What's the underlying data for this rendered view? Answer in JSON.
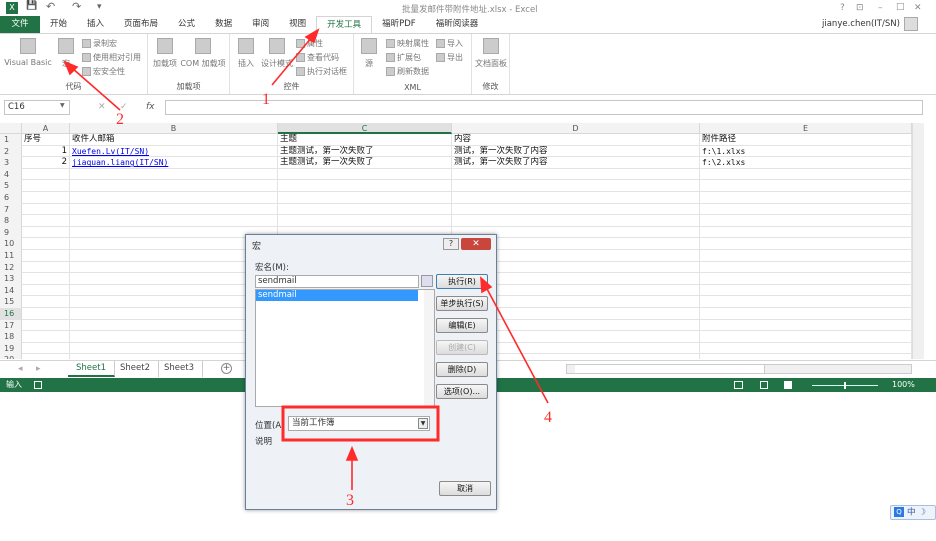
{
  "window": {
    "title": "批量发邮件带附件地址.xlsx - Excel",
    "user": "jianye.chen(IT/SN)",
    "controls": [
      "?",
      "⊡",
      "–",
      "□",
      "✕"
    ]
  },
  "quick_access": {
    "save": "💾",
    "undo": "↶",
    "redo": "↷",
    "customize": "▾"
  },
  "tabs": [
    "文件",
    "开始",
    "插入",
    "页面布局",
    "公式",
    "数据",
    "审阅",
    "视图",
    "开发工具",
    "福昕PDF",
    "福昕阅读器"
  ],
  "active_tab": "开发工具",
  "ribbon": {
    "groups": [
      {
        "label": "代码",
        "buttons": [
          "Visual Basic",
          "宏"
        ],
        "small": [
          "录制宏",
          "使用相对引用",
          "宏安全性"
        ]
      },
      {
        "label": "加载项",
        "buttons": [
          "加载项",
          "COM 加载项"
        ]
      },
      {
        "label": "控件",
        "buttons": [
          "插入",
          "设计模式"
        ],
        "small": [
          "属性",
          "查看代码",
          "执行对话框"
        ]
      },
      {
        "label": "XML",
        "buttons": [
          "源"
        ],
        "small": [
          "映射属性",
          "扩展包",
          "刷新数据",
          "导入",
          "导出"
        ]
      },
      {
        "label": "修改",
        "buttons": [
          "文档面板"
        ]
      }
    ]
  },
  "formula_bar": {
    "name_box": "C16",
    "cancel": "✕",
    "enter": "✓",
    "fx": "fx",
    "value": ""
  },
  "sheet": {
    "columns": [
      "A",
      "B",
      "C",
      "D",
      "E"
    ],
    "selected_column": "C",
    "selected_row": 16,
    "row_count": 20,
    "rows": [
      [
        "序号",
        "收件人邮箱",
        "主题",
        "内容",
        "附件路径"
      ],
      [
        "1",
        "Xuefen.Lv(IT/SN)",
        "主题测试，第一次失败了",
        "测试，第一次失败了内容",
        "f:\\1.xlxs"
      ],
      [
        "2",
        "jiaquan.liang(IT/SN)",
        "主题测试，第一次失败了",
        "测试，第一次失败了内容",
        "f:\\2.xlxs"
      ]
    ]
  },
  "sheet_tabs": [
    "Sheet1",
    "Sheet2",
    "Sheet3"
  ],
  "active_sheet": "Sheet1",
  "status": {
    "mode": "输入",
    "zoom": "100%"
  },
  "dialog": {
    "title": "宏",
    "name_label": "宏名(M):",
    "name_value": "sendmail",
    "list": [
      "sendmail"
    ],
    "buttons": [
      "执行(R)",
      "单步执行(S)",
      "编辑(E)",
      "创建(C)",
      "删除(D)",
      "选项(O)..."
    ],
    "disabled": "创建(C)",
    "location_label": "位置(A)",
    "location_value": "当前工作簿",
    "description_label": "说明",
    "cancel": "取消"
  },
  "annotations": [
    "1",
    "2",
    "3",
    "4"
  ],
  "annotation_color": "#ff2a2a",
  "ime": {
    "lang": "中",
    "moon": "☽"
  },
  "colors": {
    "excel_green": "#217346",
    "link": "#0000ee"
  }
}
